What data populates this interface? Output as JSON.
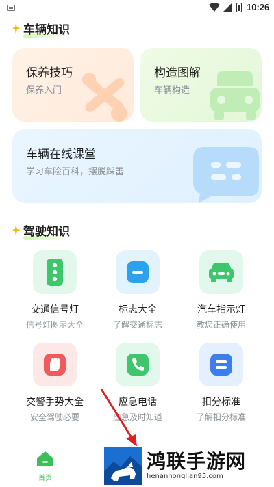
{
  "status_bar": {
    "time": "10:26"
  },
  "section_vehicle": {
    "title": "车辆知识"
  },
  "cards": {
    "maintenance": {
      "title": "保养技巧",
      "sub": "保养入门"
    },
    "structure": {
      "title": "构造图解",
      "sub": "车辆构造"
    },
    "classroom": {
      "title": "车辆在线课堂",
      "sub": "学习车险百科，摆脱踩雷"
    }
  },
  "section_driving": {
    "title": "驾驶知识"
  },
  "driving_items": [
    {
      "label": "交通信号灯",
      "sub": "信号灯图示大全",
      "icon": "traffic-light-icon",
      "bg": "#e3f8ec",
      "fg": "#3dc66b"
    },
    {
      "label": "标志大全",
      "sub": "了解交通标志",
      "icon": "sign-icon",
      "bg": "#e2f3fd",
      "fg": "#2ba3ec"
    },
    {
      "label": "汽车指示灯",
      "sub": "教您正确使用",
      "icon": "car-icon",
      "bg": "#e3f8ec",
      "fg": "#3dc66b"
    },
    {
      "label": "交警手势大全",
      "sub": "安全驾驶必要",
      "icon": "hand-icon",
      "bg": "#fde8e8",
      "fg": "#f05a5a"
    },
    {
      "label": "应急电话",
      "sub": "应急及时知道",
      "icon": "phone-icon",
      "bg": "#e3f8ec",
      "fg": "#3dc66b"
    },
    {
      "label": "扣分标准",
      "sub": "了解扣分标准",
      "icon": "list-icon",
      "bg": "#e4efff",
      "fg": "#3b7ef0"
    }
  ],
  "bottom_nav": {
    "home_label": "首页"
  },
  "watermark": {
    "title": "鸿联手游网",
    "url": "henanhonglian95.com"
  }
}
